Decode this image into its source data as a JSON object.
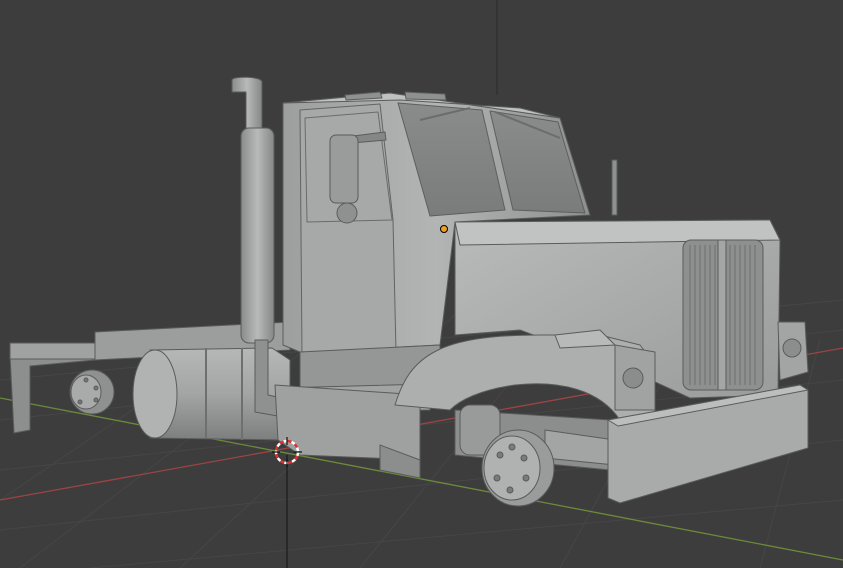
{
  "viewport": {
    "mode": "3D Viewport",
    "shading": "solid",
    "background_color": "#3d3d3d",
    "grid_line_color": "#464646",
    "x_axis_color": "#9c4444",
    "y_axis_color": "#6b8a3a",
    "z_axis_color": "#1a1a1a"
  },
  "scene": {
    "objects": [
      {
        "name": "truck-cab",
        "type": "mesh"
      },
      {
        "name": "truck-hood",
        "type": "mesh"
      },
      {
        "name": "exhaust-stack",
        "type": "mesh"
      },
      {
        "name": "fuel-tank",
        "type": "mesh"
      },
      {
        "name": "front-bumper",
        "type": "mesh"
      },
      {
        "name": "front-wheel-hub",
        "type": "mesh"
      },
      {
        "name": "rear-wheel-hub",
        "type": "mesh"
      },
      {
        "name": "mud-flap",
        "type": "mesh"
      }
    ],
    "mesh_color": "#a9abab",
    "selected_origin_color": "#f0a020"
  },
  "cursor_3d": {
    "icon": "3d-cursor-icon",
    "colors": [
      "#e03030",
      "#ffffff"
    ]
  }
}
